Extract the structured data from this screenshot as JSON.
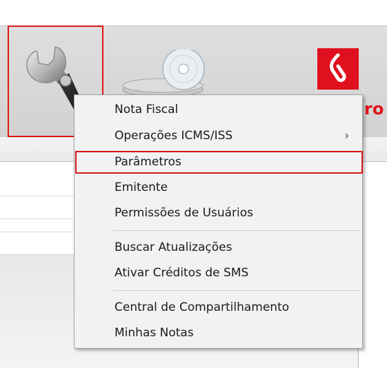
{
  "toolbar": {
    "buttons": [
      {
        "icon": "wrench-icon"
      },
      {
        "icon": "disc-icon"
      }
    ],
    "brand": {
      "logo": "brand-logo-icon",
      "text_partial": "ro",
      "color": "#e0101e"
    }
  },
  "menu": {
    "groups": [
      [
        {
          "label": "Nota Fiscal"
        },
        {
          "label": "Operações ICMS/ISS",
          "submenu_indicator": "›"
        },
        {
          "label": "Parâmetros"
        },
        {
          "label": "Emitente"
        },
        {
          "label": "Permissões de Usuários"
        }
      ],
      [
        {
          "label": "Buscar Atualizações"
        },
        {
          "label": "Ativar Créditos de SMS"
        }
      ],
      [
        {
          "label": "Central de Compartilhamento"
        },
        {
          "label": "Minhas Notas"
        }
      ]
    ]
  },
  "annotations": {
    "highlight_color": "#e01515"
  }
}
